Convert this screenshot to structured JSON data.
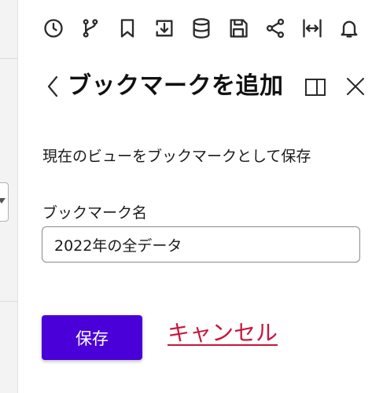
{
  "toolbar": {
    "items": [
      {
        "name": "history-icon",
        "label": ""
      },
      {
        "name": "branch-icon",
        "label": ""
      },
      {
        "name": "bookmark-icon",
        "label": ""
      },
      {
        "name": "download-icon",
        "label": ""
      },
      {
        "name": "database-icon",
        "label": ""
      },
      {
        "name": "save-icon",
        "label": ""
      },
      {
        "name": "share-icon",
        "label": ""
      },
      {
        "name": "fit-width-icon",
        "label": ""
      },
      {
        "name": "bell-icon",
        "label": ""
      }
    ]
  },
  "panel": {
    "title": "ブックマークを追加",
    "back_icon": "chevron-left-icon",
    "dock_icon": "dock-panel-icon",
    "close_icon": "close-icon",
    "description": "現在のビューをブックマークとして保存",
    "field_label": "ブックマーク名",
    "input_value": "2022年の全データ",
    "save_label": "保存",
    "cancel_label": "キャンセル"
  },
  "colors": {
    "primary": "#4a00d8",
    "cancel": "#c8153c",
    "icon": "#2b2b2b"
  }
}
